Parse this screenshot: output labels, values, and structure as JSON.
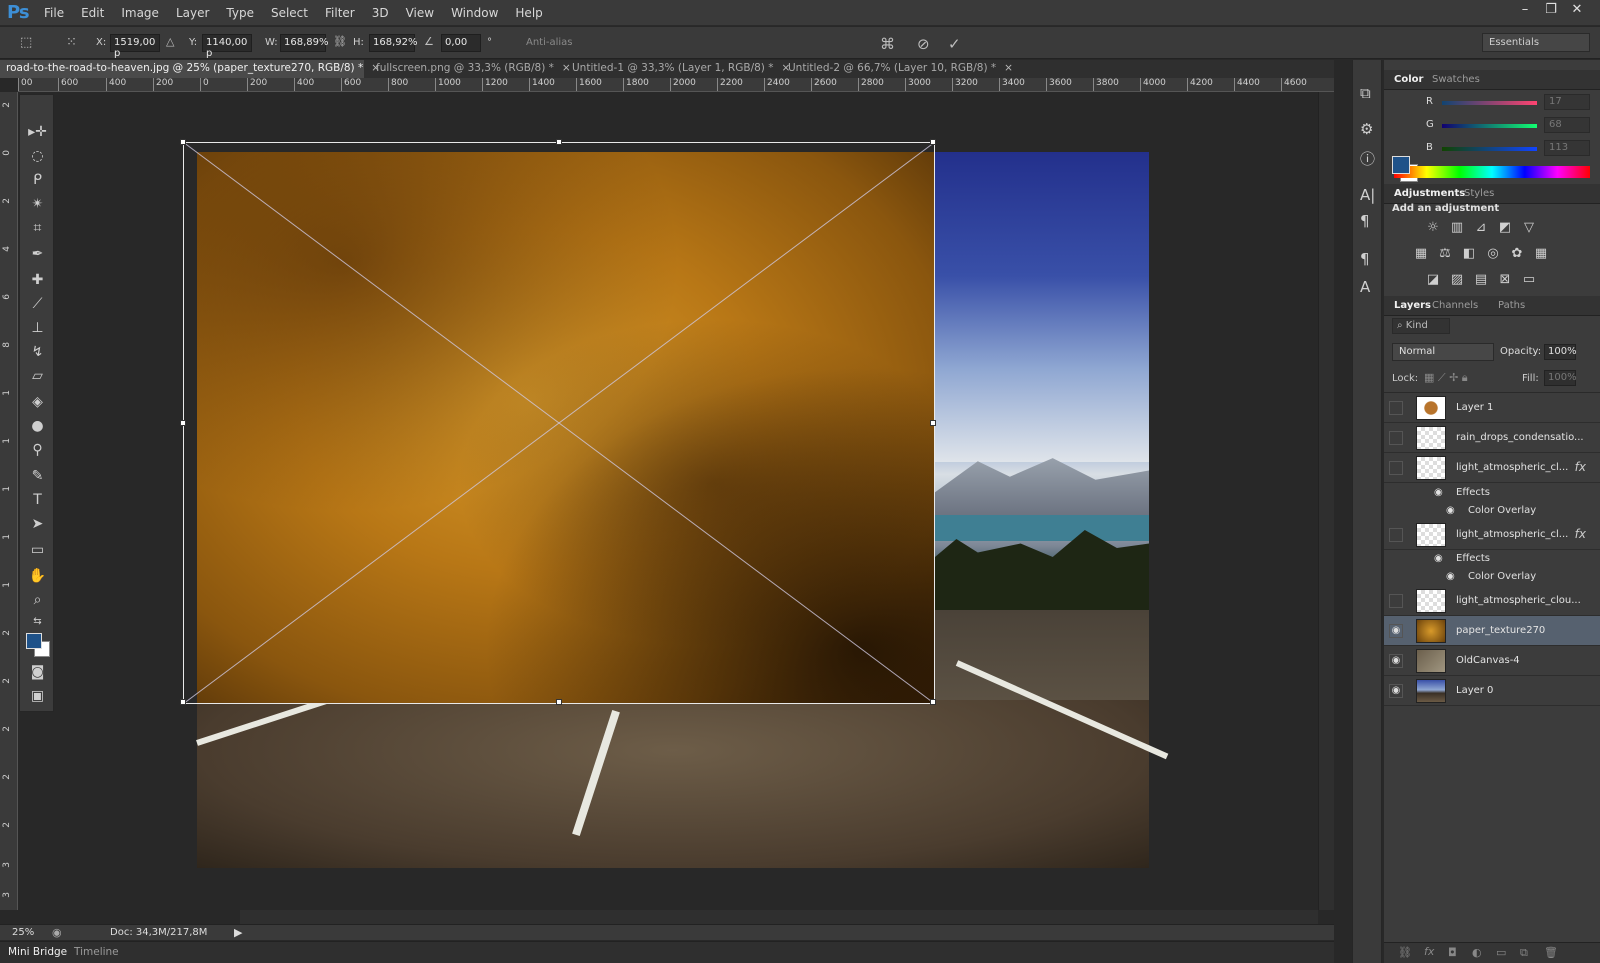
{
  "app": {
    "logo": "Ps"
  },
  "menu": [
    "File",
    "Edit",
    "Image",
    "Layer",
    "Type",
    "Select",
    "Filter",
    "3D",
    "View",
    "Window",
    "Help"
  ],
  "window_controls": [
    "–",
    "❐",
    "✕"
  ],
  "options_bar": {
    "x_label": "X:",
    "x_value": "1519,00 p",
    "y_label": "Y:",
    "y_value": "1140,00 p",
    "w_label": "W:",
    "w_value": "168,89%",
    "h_label": "H:",
    "h_value": "168,92%",
    "angle_value": "0,00",
    "degree": "°",
    "antialias_label": "Anti-alias",
    "workspace": "Essentials"
  },
  "doc_tabs": [
    {
      "label": "road-to-the-road-to-heaven.jpg @ 25% (paper_texture270, RGB/8) *",
      "active": true
    },
    {
      "label": "fullscreen.png @ 33,3% (RGB/8) *",
      "active": false
    },
    {
      "label": "Untitled-1 @ 33,3% (Layer 1, RGB/8) *",
      "active": false
    },
    {
      "label": "Untitled-2 @ 66,7% (Layer 10, RGB/8) *",
      "active": false
    }
  ],
  "ruler_top": [
    "00",
    "600",
    "400",
    "200",
    "0",
    "200",
    "400",
    "600",
    "800",
    "1000",
    "1200",
    "1400",
    "1600",
    "1800",
    "2000",
    "2200",
    "2400",
    "2600",
    "2800",
    "3000",
    "3200",
    "3400",
    "3600",
    "3800",
    "4000",
    "4200",
    "4400",
    "4600"
  ],
  "ruler_left": [
    "2",
    "0",
    "2",
    "4",
    "6",
    "8",
    "1",
    "1",
    "1",
    "1",
    "1",
    "2",
    "2",
    "2",
    "2",
    "2",
    "3",
    "3"
  ],
  "status": {
    "zoom": "25%",
    "doc": "Doc: 34,3M/217,8M"
  },
  "bottom_tabs": [
    "Mini Bridge",
    "Timeline"
  ],
  "color_panel": {
    "tabs": [
      "Color",
      "Swatches"
    ],
    "r_label": "R",
    "r_value": "17",
    "g_label": "G",
    "g_value": "68",
    "b_label": "B",
    "b_value": "113",
    "foreground": "#1f5289",
    "background": "#ffffff"
  },
  "adjustments_panel": {
    "tabs": [
      "Adjustments",
      "Styles"
    ],
    "title": "Add an adjustment"
  },
  "layers_panel": {
    "tabs": [
      "Layers",
      "Channels",
      "Paths"
    ],
    "kind": "Kind",
    "blend_mode": "Normal",
    "opacity_label": "Opacity:",
    "opacity_value": "100%",
    "lock_label": "Lock:",
    "fill_label": "Fill:",
    "fill_value": "100%",
    "layers": [
      {
        "name": "Layer 1",
        "visible": false,
        "fx": false
      },
      {
        "name": "rain_drops_condensatio...",
        "visible": false,
        "fx": false
      },
      {
        "name": "light_atmospheric_cl...",
        "visible": false,
        "fx": true,
        "effects_label": "Effects",
        "effect": "Color Overlay"
      },
      {
        "name": "light_atmospheric_cl...",
        "visible": false,
        "fx": true,
        "effects_label": "Effects",
        "effect": "Color Overlay"
      },
      {
        "name": "light_atmospheric_clou...",
        "visible": false,
        "fx": false
      },
      {
        "name": "paper_texture270",
        "visible": true,
        "fx": false,
        "selected": true
      },
      {
        "name": "OldCanvas-4",
        "visible": true,
        "fx": false
      },
      {
        "name": "Layer 0",
        "visible": true,
        "fx": false
      }
    ],
    "fx_symbol": "fx"
  }
}
